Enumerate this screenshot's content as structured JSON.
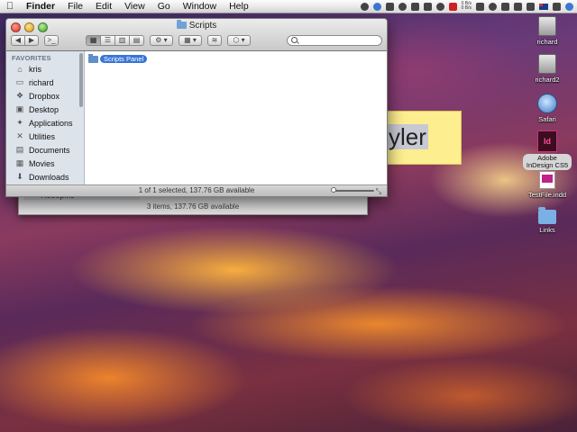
{
  "menubar": {
    "apple": "",
    "items": [
      "Finder",
      "File",
      "Edit",
      "View",
      "Go",
      "Window",
      "Help"
    ],
    "net_in": "0 B/s",
    "net_out": "0 B/s"
  },
  "finder": {
    "title": "Scripts",
    "search_placeholder": "",
    "toolbar": {
      "back_label": "◀",
      "forward_label": "▶",
      "action_label": "⚙ ▾",
      "arrange_label": "▦ ▾",
      "dropbox_label": "⬡ ▾"
    },
    "sidebar": {
      "heading": "FAVORITES",
      "items": [
        "kris",
        "richard",
        "Dropbox",
        "Desktop",
        "Applications",
        "Utilities",
        "Documents",
        "Movies",
        "Downloads"
      ]
    },
    "files": [
      "Scripts Panel"
    ],
    "status": "1 of 1 selected, 137.76 GB available"
  },
  "background_window": {
    "row_label": "Robopiko",
    "status": "3 items, 137.76 GB available"
  },
  "sticky": {
    "text": "yler"
  },
  "desktop_icons": [
    "richard",
    "richard2",
    "Safari",
    "Adobe InDesign CS5",
    "TestFile.indd",
    "Links"
  ],
  "colors": {
    "selection": "#3875d7",
    "sidebar_bg": "#dde3ea",
    "sticky_bg": "#fdee8f"
  }
}
